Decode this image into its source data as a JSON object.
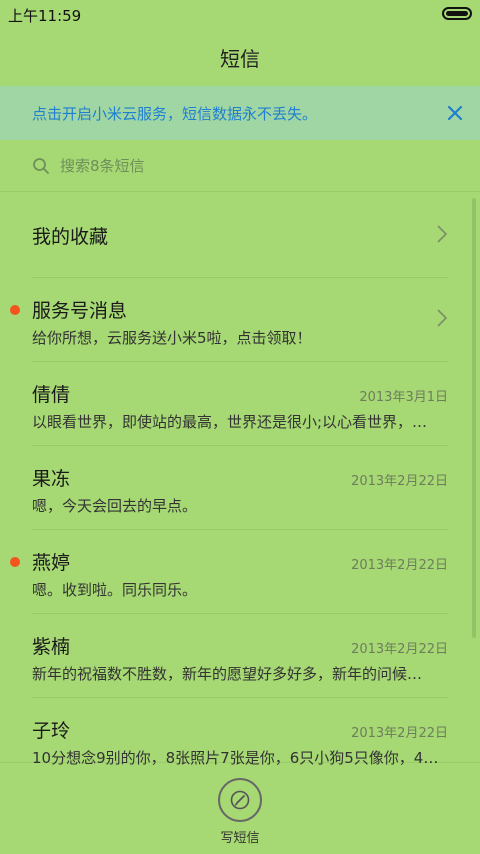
{
  "status": {
    "time": "上午11:59"
  },
  "header": {
    "title": "短信"
  },
  "banner": {
    "text": "点击开启小米云服务，短信数据永不丢失。"
  },
  "search": {
    "placeholder": "搜索8条短信"
  },
  "threads": [
    {
      "name": "我的收藏",
      "date": "",
      "snippet": "",
      "unread": false,
      "chevron": true
    },
    {
      "name": "服务号消息",
      "date": "",
      "snippet": "给你所想，云服务送小米5啦，点击领取！",
      "unread": true,
      "chevron": true
    },
    {
      "name": "倩倩",
      "date": "2013年3月1日",
      "snippet": "以眼看世界，即使站的最高，世界还是很小;以心看世界，…",
      "unread": false,
      "chevron": false
    },
    {
      "name": "果冻",
      "date": "2013年2月22日",
      "snippet": "嗯，今天会回去的早点。",
      "unread": false,
      "chevron": false
    },
    {
      "name": "燕婷",
      "date": "2013年2月22日",
      "snippet": "嗯。收到啦。同乐同乐。",
      "unread": true,
      "chevron": false
    },
    {
      "name": "紫楠",
      "date": "2013年2月22日",
      "snippet": "新年的祝福数不胜数，新年的愿望好多好多，新年的问候…",
      "unread": false,
      "chevron": false
    },
    {
      "name": "子玲",
      "date": "2013年2月22日",
      "snippet": "10分想念9别的你，8张照片7张是你，6只小狗5只像你，4…",
      "unread": false,
      "chevron": false
    }
  ],
  "bottom": {
    "compose_label": "写短信"
  },
  "icons": {
    "battery": "battery-icon",
    "close": "close-icon",
    "search": "search-icon",
    "chevron": "chevron-right-icon",
    "compose": "compose-icon"
  },
  "colors": {
    "background": "#a6d873",
    "banner_bg": "#9fd6a4",
    "banner_text": "#1f7fd0",
    "unread_dot": "#f5541d"
  }
}
